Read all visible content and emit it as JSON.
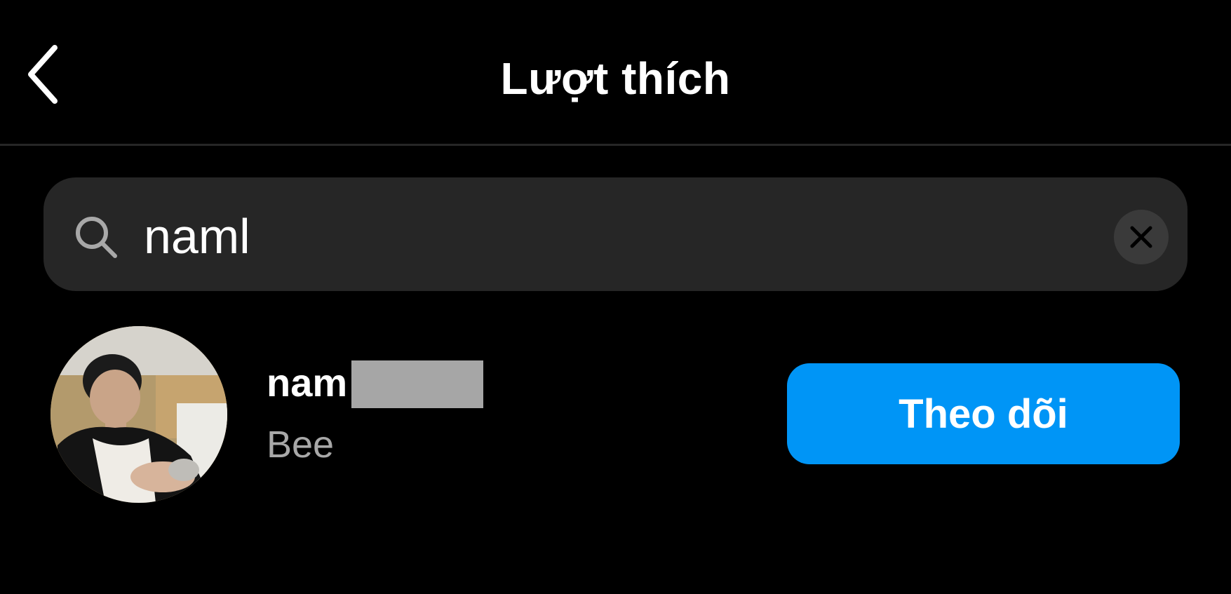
{
  "header": {
    "title": "Lượt thích",
    "back_icon": "chevron-left-icon"
  },
  "search": {
    "value": "naml",
    "icon": "search-icon",
    "clear_icon": "close-icon"
  },
  "results": [
    {
      "username_visible": "nam",
      "username_redacted": true,
      "full_name": "Bee",
      "action_label": "Theo dõi"
    }
  ],
  "colors": {
    "background": "#000000",
    "search_background": "#262626",
    "follow_button": "#0095f6",
    "secondary_text": "#a8a8a8",
    "divider": "#262626"
  }
}
